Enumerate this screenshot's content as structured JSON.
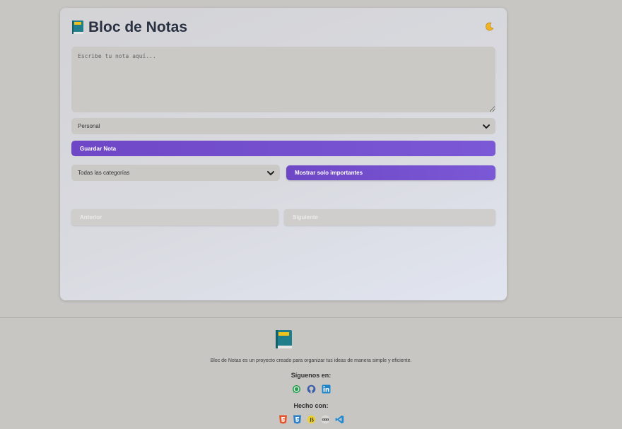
{
  "app": {
    "title": "Bloc de Notas",
    "theme_toggle_icon": "moon-icon"
  },
  "editor": {
    "placeholder": "Escribe tu nota aquí...",
    "category_selected": "Personal",
    "save_label": "Guardar Nota"
  },
  "filters": {
    "category_selected": "Todas las categorías",
    "important_label": "Mostrar solo importantes"
  },
  "pagination": {
    "prev_label": "Anterior",
    "next_label": "Siguiente"
  },
  "footer": {
    "description": "Bloc de Notas es un proyecto creado para organizar tus ideas de manera simple y eficiente.",
    "follow_heading": "Síguenos en:",
    "follow_icons": [
      "whatsapp-icon",
      "github-icon",
      "linkedin-icon"
    ],
    "made_heading": "Hecho con:",
    "tech_icons": [
      "html5-icon",
      "css3-icon",
      "javascript-icon",
      "nodejs-icon",
      "vscode-icon"
    ]
  },
  "colors": {
    "accent": "#6e47c6",
    "background": "#c8c6c3",
    "title": "#2a3142"
  }
}
